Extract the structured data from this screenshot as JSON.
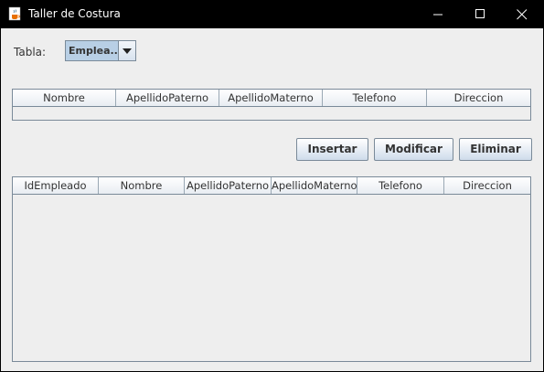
{
  "window": {
    "title": "Taller de Costura"
  },
  "form": {
    "tabla_label": "Tabla:",
    "combo_selected": "Emplea..."
  },
  "form_table": {
    "columns": [
      "Nombre",
      "ApellidoPaterno",
      "ApellidoMaterno",
      "Telefono",
      "Direccion"
    ]
  },
  "buttons": {
    "insertar": "Insertar",
    "modificar": "Modificar",
    "eliminar": "Eliminar"
  },
  "data_table": {
    "columns": [
      "IdEmpleado",
      "Nombre",
      "ApellidoPaterno",
      "ApellidoMaterno",
      "Telefono",
      "Direccion"
    ],
    "rows": []
  },
  "colors": {
    "title_bar": "#000000",
    "panel": "#eeeeee",
    "combo_selected_bg": "#b8cfe5",
    "border": "#7a8a99"
  }
}
